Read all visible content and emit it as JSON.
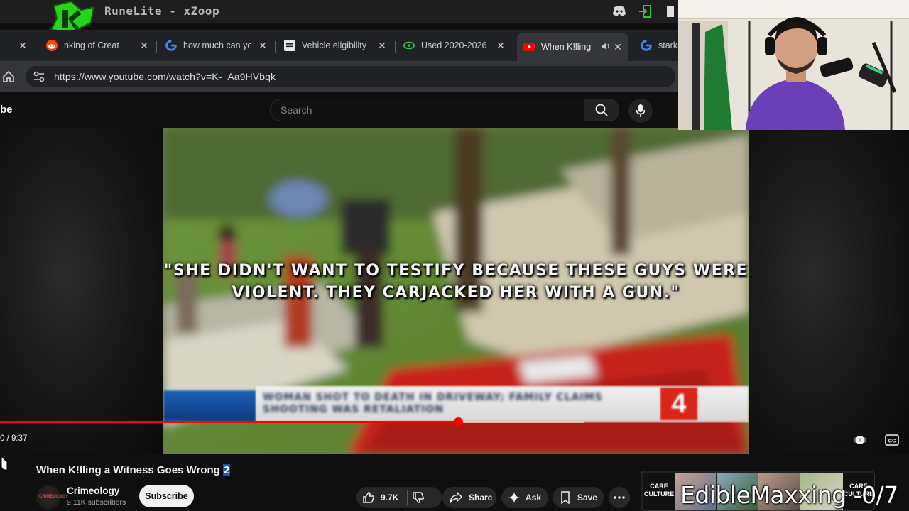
{
  "window": {
    "title": "RuneLite - xZoop"
  },
  "browser": {
    "tabs": [
      {
        "label": "nking of Creat",
        "favicon": "reddit-icon"
      },
      {
        "label": "how much can yo",
        "favicon": "google-icon"
      },
      {
        "label": "Vehicle eligibility",
        "favicon": "document-icon"
      },
      {
        "label": "Used 2020-2026 ",
        "favicon": "car-site-icon"
      },
      {
        "label": "When K!lling",
        "favicon": "youtube-icon",
        "active": true,
        "audio": "speaker-icon"
      },
      {
        "label": "starki",
        "favicon": "google-icon"
      }
    ],
    "url": "https://www.youtube.com/watch?v=K-_Aa9HVbqk"
  },
  "youtube": {
    "brand_fragment": "be",
    "search_placeholder": "Search",
    "video": {
      "quote": "\"SHE DIDN'T WANT TO TESTIFY BECAUSE THESE GUYS WERE VIOLENT. THEY CARJACKED HER WITH A GUN.\"",
      "chyron": "WOMAN SHOT TO DEATH IN DRIVEWAY; FAMILY CLAIMS SHOOTING WAS RETALIATION",
      "station": "4",
      "timecode": "0 / 9:37",
      "progress_fraction": 0.612,
      "buffered_fraction": 0.78
    },
    "title_main": "When K!lling a Witness Goes Wrong ",
    "title_highlight": "2",
    "channel": {
      "name": "Crimeology",
      "subscribers": "9.11K subscribers",
      "avatar_text": "CRIMEOLOGY"
    },
    "subscribe_label": "Subscribe",
    "actions": {
      "likes": "9.7K",
      "share": "Share",
      "ask": "Ask",
      "save": "Save"
    }
  },
  "stream_overlay": {
    "text": "EdibleMaxxing -0/7",
    "store_badge": "CARE CULTURE"
  },
  "colors": {
    "yt_red": "#ff0000",
    "accent_blue": "#1a53c5",
    "runelite_green": "#2ad31e"
  }
}
